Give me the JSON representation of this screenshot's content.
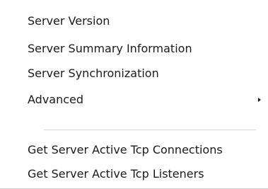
{
  "menu": {
    "items": [
      {
        "label": "Server Version"
      },
      {
        "label": "Server Summary Information"
      },
      {
        "label": "Server Synchronization"
      },
      {
        "label": "Advanced",
        "has_submenu": true
      }
    ],
    "items_after_separator": [
      {
        "label": "Get Server Active Tcp Connections"
      },
      {
        "label": "Get Server Active Tcp Listeners"
      }
    ],
    "icons": {
      "submenu": "chevron-right-icon"
    }
  }
}
